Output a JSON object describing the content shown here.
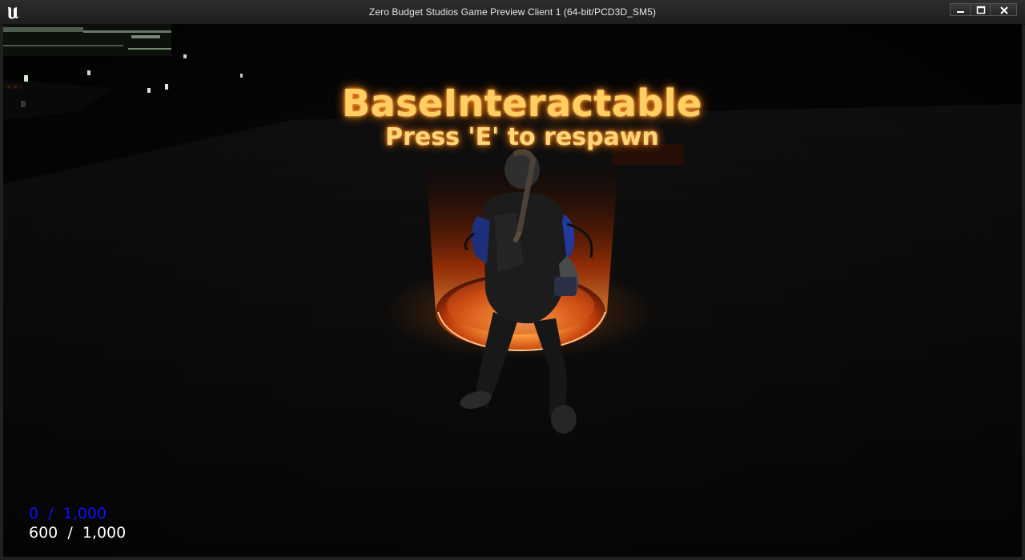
{
  "window": {
    "title": "Zero Budget Studios Game Preview Client 1 (64-bit/PCD3D_SM5)",
    "icon": "unreal-engine-logo-icon",
    "controls": [
      "minimize-icon",
      "maximize-icon",
      "close-icon"
    ]
  },
  "interaction": {
    "title": "BaseInteractable",
    "prompt": "Press 'E' to respawn",
    "glow_color": "#ff8a1c",
    "text_color": "#ffcf63"
  },
  "hud": {
    "primary": {
      "current": "0",
      "max": "1,000",
      "text": "0  /  1,000",
      "color": "#1010ff"
    },
    "secondary": {
      "current": "600",
      "max": "1,000",
      "text": "600  /  1,000",
      "color": "#ffffff"
    }
  }
}
